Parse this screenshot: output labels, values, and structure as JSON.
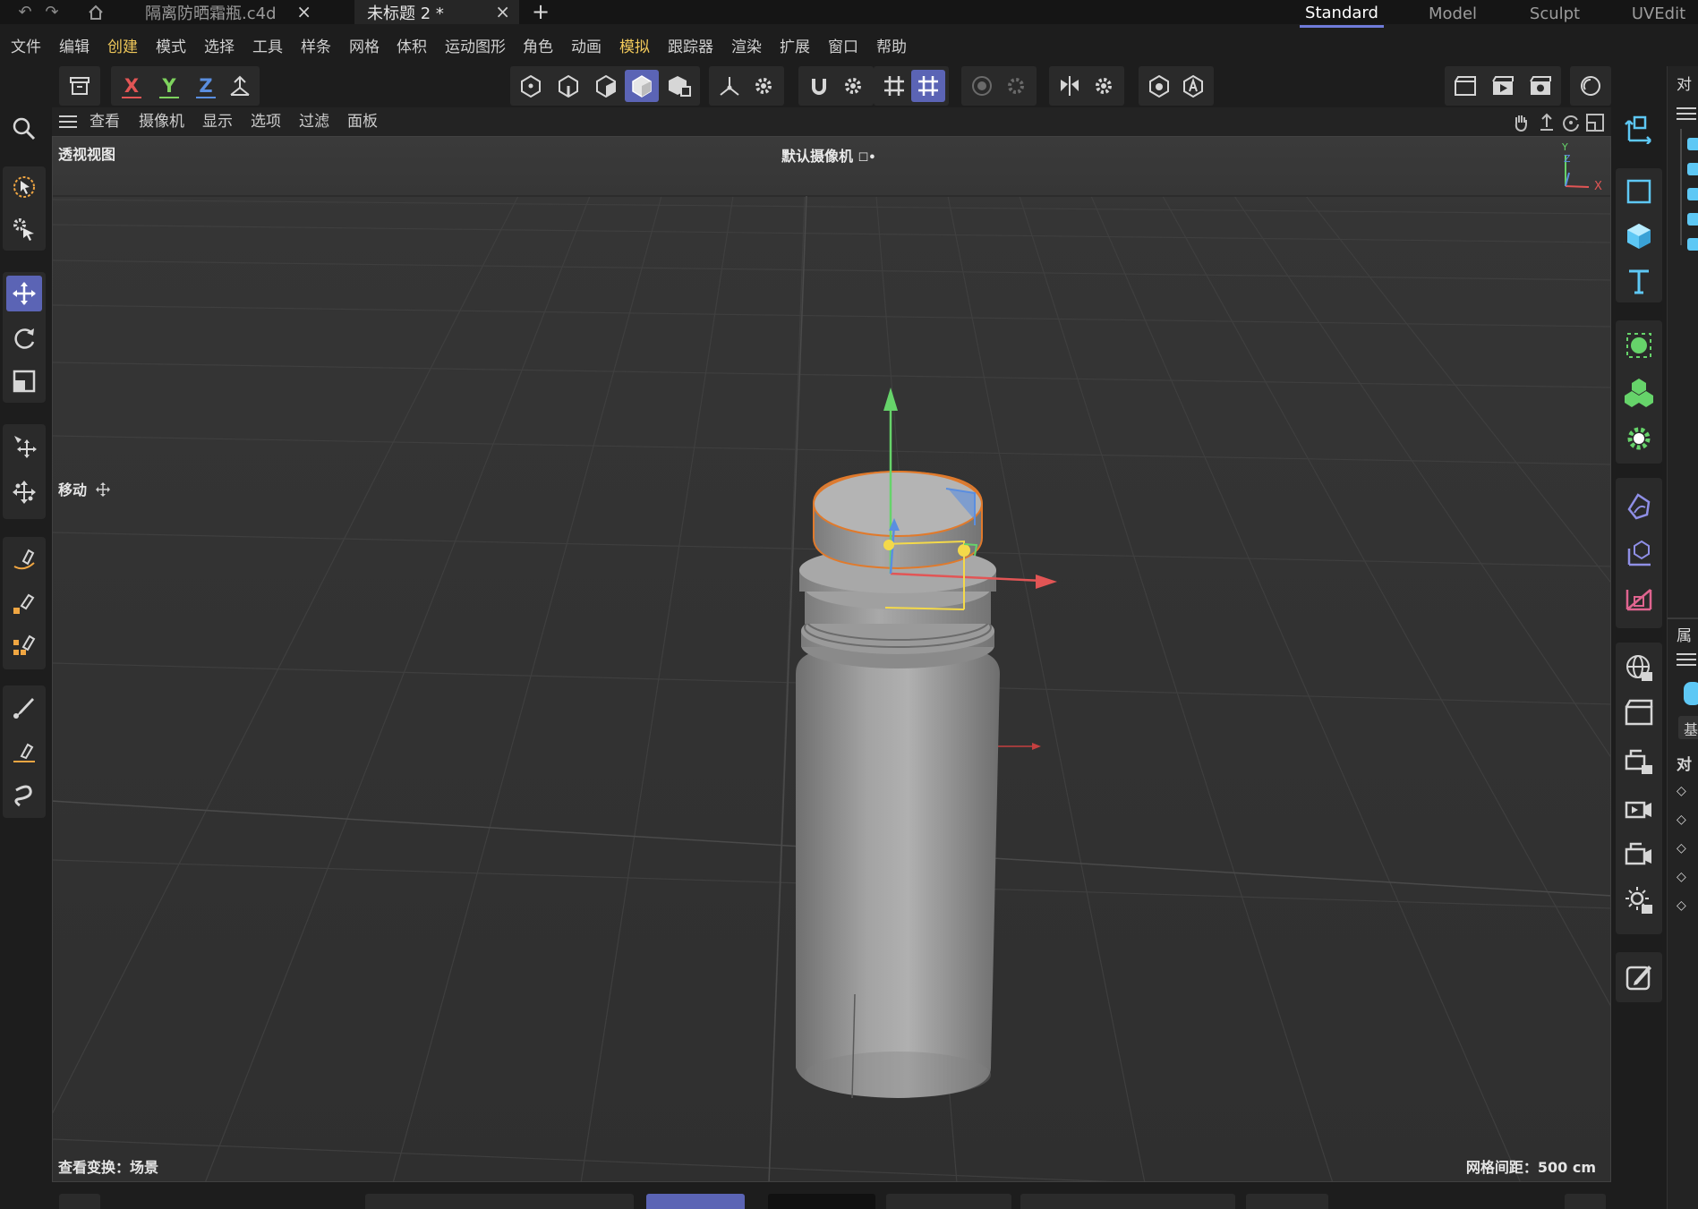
{
  "titlebar": {
    "doc_tabs": [
      {
        "label": "隔离防晒霜瓶.c4d",
        "close": "×"
      },
      {
        "label": "未标题 2 *",
        "close": "×"
      }
    ],
    "add_tab": "+",
    "layouts": [
      "Standard",
      "Model",
      "Sculpt",
      "UVEdit"
    ]
  },
  "menu": [
    "文件",
    "编辑",
    "创建",
    "模式",
    "选择",
    "工具",
    "样条",
    "网格",
    "体积",
    "运动图形",
    "角色",
    "动画",
    "模拟",
    "跟踪器",
    "渲染",
    "扩展",
    "窗口",
    "帮助"
  ],
  "toolbar": {
    "axis_x": "X",
    "axis_y": "Y",
    "axis_z": "Z"
  },
  "viewport": {
    "menu": [
      "查看",
      "摄像机",
      "显示",
      "选项",
      "过滤",
      "面板"
    ],
    "view_name": "透视视图",
    "camera": "默认摄像机",
    "camera_suffix": "☐•",
    "hud_tool": "移动",
    "view_transform": "查看变换：场景",
    "grid_spacing": "网格间距：500 cm",
    "axis_labels": {
      "x": "X",
      "y": "Y",
      "z": "Z"
    }
  },
  "panel_edge": {
    "object_title": "对",
    "attr_title": "属",
    "attr_tab": "基",
    "attr_section": "对"
  },
  "colors": {
    "accent": "#5b64b5",
    "highlight_menu": "#f1c95a",
    "axis_x": "#e25555",
    "axis_y": "#7ed35e",
    "axis_z": "#5a8ee0",
    "selection": "#e07a2c",
    "icon_blue": "#5ec8f5",
    "icon_green": "#66d36a",
    "icon_pink": "#e0648f",
    "icon_violet": "#8f8fe6"
  }
}
